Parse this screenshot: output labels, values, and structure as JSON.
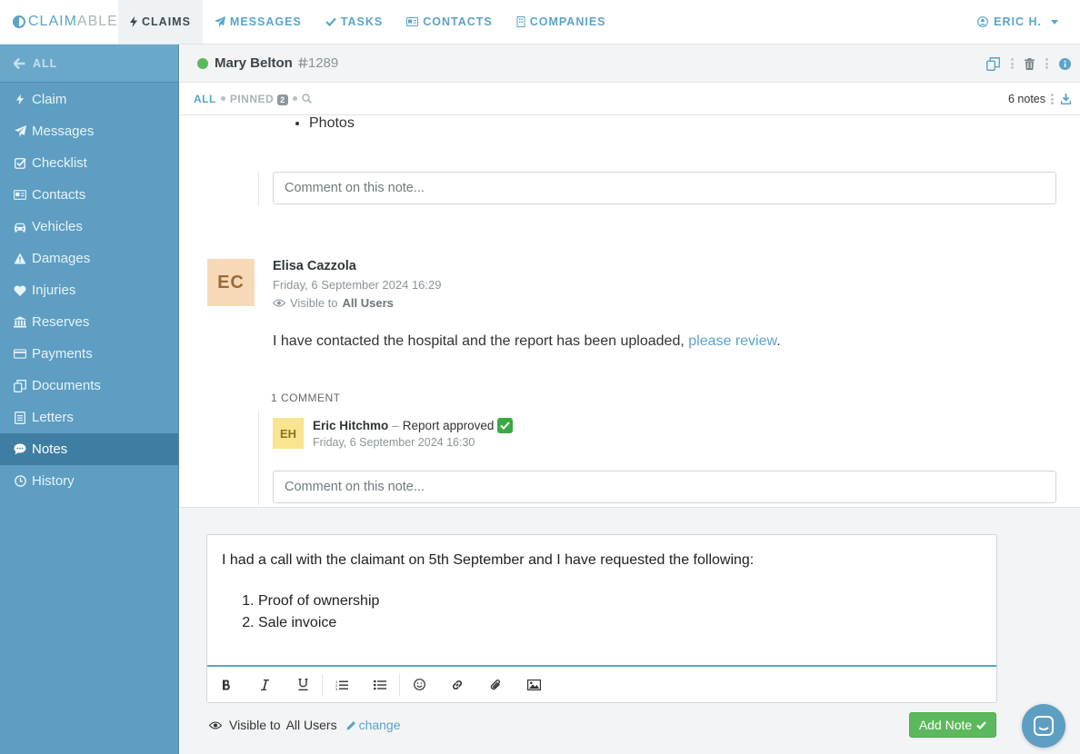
{
  "app": {
    "brand_part1": "CLAIM",
    "brand_part2": "ABLE",
    "accent_color": "#5aa4c8",
    "sidebar_color": "#5d9ec2",
    "success_color": "#5cb85c"
  },
  "topnav": {
    "tabs": [
      {
        "label": "CLAIMS",
        "icon": "bolt-icon"
      },
      {
        "label": "MESSAGES",
        "icon": "paper-plane-icon"
      },
      {
        "label": "TASKS",
        "icon": "check-icon"
      },
      {
        "label": "CONTACTS",
        "icon": "id-card-icon"
      },
      {
        "label": "COMPANIES",
        "icon": "building-icon"
      }
    ],
    "user_label": "ERIC H."
  },
  "sidebar": {
    "back_label": "ALL",
    "items": [
      {
        "label": "Claim",
        "icon": "bolt-icon"
      },
      {
        "label": "Messages",
        "icon": "paper-plane-icon"
      },
      {
        "label": "Checklist",
        "icon": "checkbox-icon"
      },
      {
        "label": "Contacts",
        "icon": "id-card-icon"
      },
      {
        "label": "Vehicles",
        "icon": "car-icon"
      },
      {
        "label": "Damages",
        "icon": "warning-icon"
      },
      {
        "label": "Injuries",
        "icon": "heart-icon"
      },
      {
        "label": "Reserves",
        "icon": "bank-icon"
      },
      {
        "label": "Payments",
        "icon": "credit-card-icon"
      },
      {
        "label": "Documents",
        "icon": "copy-icon"
      },
      {
        "label": "Letters",
        "icon": "letter-icon"
      },
      {
        "label": "Notes",
        "icon": "comment-icon"
      },
      {
        "label": "History",
        "icon": "clock-icon"
      }
    ],
    "active": "Notes"
  },
  "claim_header": {
    "claimant": "Mary Belton",
    "claim_number": "1289",
    "status": "active"
  },
  "filters": {
    "all_label": "ALL",
    "pinned_label": "PINNED",
    "pinned_count": "2",
    "notes_count": "6 notes"
  },
  "feed": {
    "previous_note_tail": {
      "bullet": "Photos",
      "comment_placeholder": "Comment on this note..."
    },
    "note": {
      "author_initials": "EC",
      "author": "Elisa Cazzola",
      "date": "Friday, 6 September 2024 16:29",
      "visible_prefix": "Visible to",
      "visible_to": "All Users",
      "body_text": "I have contacted the hospital and the report has been uploaded, ",
      "body_link": "please review",
      "body_end": ".",
      "comments_count_label": "1 COMMENT",
      "comments": [
        {
          "initials": "EH",
          "author": "Eric Hitchmo",
          "separator": "–",
          "text": "Report approved",
          "date": "Friday, 6 September 2024 16:30"
        }
      ],
      "comment_placeholder": "Comment on this note..."
    }
  },
  "composer": {
    "intro": "I had a call with the claimant on 5th September and I have requested the following:",
    "list_items": [
      "Proof of ownership",
      "Sale invoice"
    ],
    "visible_prefix": "Visible to",
    "visible_to": "All Users",
    "change_label": "change",
    "submit_label": "Add Note"
  }
}
